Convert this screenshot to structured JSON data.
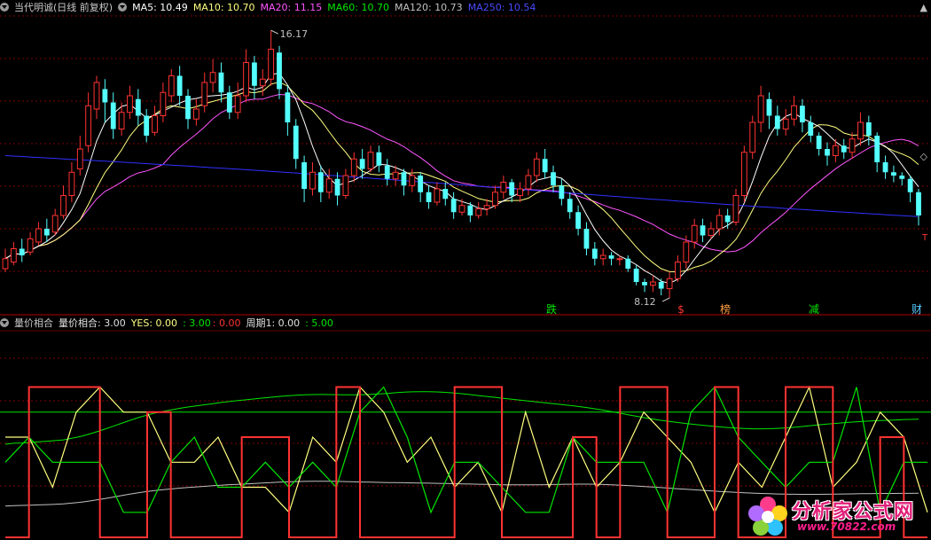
{
  "main_legend": {
    "title": "当代明诚(日线 前复权)",
    "ma5": "MA5: 10.49",
    "ma10": "MA10: 10.70",
    "ma20": "MA20: 11.15",
    "ma60": "MA60: 10.70",
    "ma120": "MA120: 10.73",
    "ma250": "MA250: 10.54"
  },
  "indicator_legend": {
    "name": "量价相合",
    "value": "量价相合: 3.00",
    "yes": "YES: 0.00",
    "green": ": 3.00",
    "red": ": 0.00",
    "period": "周期1: 0.00",
    "period_green": ": 5.00"
  },
  "annotations": {
    "high": "16.17",
    "low": "8.12",
    "markers": [
      "跌",
      "$",
      "榜",
      "减",
      "财"
    ],
    "marker_t": "T"
  },
  "watermark": {
    "title": "分析家公式网",
    "url": "www.70822.com"
  },
  "colors": {
    "up": "#ff3232",
    "down": "#54ffff",
    "ma5": "#ffffff",
    "ma10": "#ffff7f",
    "ma20": "#ff56ff",
    "ma60": "#00e600",
    "ma120": "#c0c0c0",
    "ma250": "#3030ff",
    "grid": "#800000"
  },
  "chart_data": [
    {
      "type": "candlestick",
      "series": [
        {
          "name": "MA5"
        },
        {
          "name": "MA10"
        },
        {
          "name": "MA20"
        },
        {
          "name": "MA60"
        },
        {
          "name": "MA120"
        },
        {
          "name": "MA250"
        }
      ],
      "ylim": [
        7.8,
        16.6
      ],
      "candles": [
        [
          9.0,
          9.3,
          9.6,
          8.9
        ],
        [
          9.2,
          9.6,
          9.8,
          9.1
        ],
        [
          9.6,
          9.4,
          9.9,
          9.2
        ],
        [
          9.5,
          9.9,
          10.1,
          9.4
        ],
        [
          9.8,
          10.2,
          10.4,
          9.7
        ],
        [
          10.2,
          10.0,
          10.5,
          9.8
        ],
        [
          10.1,
          10.6,
          10.8,
          10.0
        ],
        [
          10.6,
          11.2,
          11.5,
          10.5
        ],
        [
          11.2,
          11.9,
          12.2,
          11.0
        ],
        [
          12.0,
          12.6,
          13.0,
          11.8
        ],
        [
          12.7,
          13.9,
          14.3,
          12.5
        ],
        [
          13.8,
          14.6,
          14.8,
          13.5
        ],
        [
          14.4,
          14.0,
          14.7,
          13.4
        ],
        [
          14.0,
          13.2,
          14.3,
          12.9
        ],
        [
          13.2,
          13.7,
          14.0,
          13.0
        ],
        [
          13.7,
          14.2,
          14.5,
          13.5
        ],
        [
          14.1,
          13.6,
          14.4,
          13.3
        ],
        [
          13.6,
          13.0,
          13.8,
          12.8
        ],
        [
          13.1,
          13.6,
          13.9,
          13.0
        ],
        [
          13.6,
          14.3,
          14.6,
          13.4
        ],
        [
          14.2,
          14.8,
          15.0,
          14.0
        ],
        [
          14.8,
          14.2,
          15.1,
          13.9
        ],
        [
          14.2,
          13.5,
          14.4,
          13.2
        ],
        [
          13.5,
          13.8,
          14.1,
          13.3
        ],
        [
          13.9,
          14.6,
          14.9,
          13.7
        ],
        [
          14.6,
          14.9,
          15.3,
          14.3
        ],
        [
          14.9,
          14.3,
          15.2,
          14.0
        ],
        [
          14.3,
          13.7,
          14.5,
          13.5
        ],
        [
          13.7,
          14.2,
          14.6,
          13.5
        ],
        [
          14.2,
          15.2,
          15.6,
          14.0
        ],
        [
          15.2,
          14.5,
          15.4,
          14.1
        ],
        [
          14.5,
          14.7,
          15.0,
          14.2
        ],
        [
          14.7,
          15.6,
          16.17,
          14.5
        ],
        [
          15.5,
          14.4,
          15.7,
          14.1
        ],
        [
          14.3,
          13.4,
          14.5,
          13.0
        ],
        [
          13.3,
          12.3,
          13.5,
          12.0
        ],
        [
          12.2,
          11.4,
          12.4,
          11.0
        ],
        [
          11.4,
          11.9,
          12.2,
          11.2
        ],
        [
          11.9,
          11.3,
          12.1,
          11.0
        ],
        [
          11.3,
          11.7,
          12.0,
          11.1
        ],
        [
          11.7,
          11.2,
          11.9,
          10.9
        ],
        [
          11.2,
          11.8,
          12.0,
          11.1
        ],
        [
          11.8,
          12.3,
          12.5,
          11.6
        ],
        [
          12.3,
          12.0,
          12.6,
          11.7
        ],
        [
          12.0,
          12.5,
          12.7,
          11.9
        ],
        [
          12.5,
          12.1,
          12.7,
          11.9
        ],
        [
          12.1,
          11.7,
          12.3,
          11.5
        ],
        [
          11.7,
          11.9,
          12.1,
          11.5
        ],
        [
          11.9,
          11.5,
          12.0,
          11.2
        ],
        [
          11.5,
          11.8,
          12.0,
          11.3
        ],
        [
          11.8,
          11.3,
          11.9,
          11.0
        ],
        [
          11.3,
          11.0,
          11.5,
          10.8
        ],
        [
          11.0,
          11.4,
          11.6,
          10.9
        ],
        [
          11.4,
          11.1,
          11.6,
          10.9
        ],
        [
          11.1,
          10.7,
          11.3,
          10.5
        ],
        [
          10.7,
          10.9,
          11.1,
          10.6
        ],
        [
          10.9,
          10.6,
          11.0,
          10.4
        ],
        [
          10.6,
          10.8,
          11.0,
          10.5
        ],
        [
          10.8,
          10.9,
          11.1,
          10.6
        ],
        [
          10.9,
          11.3,
          11.5,
          10.8
        ],
        [
          11.3,
          11.6,
          11.8,
          11.1
        ],
        [
          11.6,
          11.2,
          11.7,
          11.0
        ],
        [
          11.2,
          11.4,
          11.6,
          11.0
        ],
        [
          11.4,
          11.8,
          12.0,
          11.2
        ],
        [
          11.8,
          12.3,
          12.5,
          11.6
        ],
        [
          12.3,
          11.9,
          12.6,
          11.7
        ],
        [
          11.9,
          11.5,
          12.1,
          11.3
        ],
        [
          11.5,
          11.1,
          11.7,
          10.9
        ],
        [
          11.1,
          10.7,
          11.3,
          10.5
        ],
        [
          10.7,
          10.2,
          10.9,
          10.0
        ],
        [
          10.2,
          9.6,
          10.4,
          9.4
        ],
        [
          9.6,
          9.3,
          9.8,
          9.1
        ],
        [
          9.3,
          9.4,
          9.6,
          9.1
        ],
        [
          9.4,
          9.3,
          9.5,
          9.1
        ],
        [
          9.3,
          9.3,
          9.4,
          9.1
        ],
        [
          9.3,
          9.0,
          9.4,
          8.9
        ],
        [
          9.0,
          8.6,
          9.1,
          8.5
        ],
        [
          8.6,
          8.5,
          8.7,
          8.3
        ],
        [
          8.5,
          8.6,
          8.8,
          8.3
        ],
        [
          8.6,
          8.4,
          8.7,
          8.2
        ],
        [
          8.4,
          8.7,
          8.9,
          8.12
        ],
        [
          8.7,
          9.2,
          9.4,
          8.6
        ],
        [
          9.2,
          9.8,
          10.0,
          9.0
        ],
        [
          9.8,
          10.3,
          10.5,
          9.6
        ],
        [
          10.3,
          10.0,
          10.5,
          9.8
        ],
        [
          10.0,
          10.2,
          10.4,
          9.9
        ],
        [
          10.2,
          10.6,
          10.8,
          10.0
        ],
        [
          10.6,
          10.4,
          10.8,
          10.2
        ],
        [
          10.4,
          11.2,
          11.4,
          10.3
        ],
        [
          11.2,
          12.5,
          12.7,
          11.0
        ],
        [
          12.5,
          13.4,
          13.6,
          12.3
        ],
        [
          13.4,
          14.2,
          14.5,
          13.1
        ],
        [
          14.1,
          13.6,
          14.3,
          13.2
        ],
        [
          13.6,
          13.2,
          13.9,
          13.0
        ],
        [
          13.2,
          13.5,
          13.8,
          13.0
        ],
        [
          13.5,
          13.9,
          14.2,
          13.3
        ],
        [
          13.9,
          13.4,
          14.1,
          13.1
        ],
        [
          13.4,
          13.0,
          13.6,
          12.8
        ],
        [
          13.0,
          12.6,
          13.1,
          12.4
        ],
        [
          12.6,
          12.4,
          12.8,
          12.1
        ],
        [
          12.4,
          12.7,
          12.9,
          12.2
        ],
        [
          12.7,
          12.5,
          12.9,
          12.3
        ],
        [
          12.5,
          12.9,
          13.1,
          12.3
        ],
        [
          12.9,
          13.4,
          13.7,
          12.7
        ],
        [
          13.4,
          13.0,
          13.6,
          12.7
        ],
        [
          13.0,
          12.2,
          13.1,
          11.9
        ],
        [
          12.2,
          11.9,
          12.4,
          11.7
        ],
        [
          11.9,
          11.8,
          12.1,
          11.6
        ],
        [
          11.8,
          11.7,
          11.9,
          11.5
        ],
        [
          11.7,
          11.3,
          11.8,
          11.0
        ],
        [
          11.3,
          10.6,
          11.4,
          10.3
        ]
      ]
    },
    {
      "type": "line",
      "title": "量价相合",
      "ylim": [
        0,
        8
      ],
      "reference_line": 5.0,
      "series": [
        {
          "name": "YES",
          "values": [
            4,
            4,
            2,
            5,
            6,
            5,
            5,
            3,
            3,
            4,
            2,
            2,
            1,
            4,
            3,
            6,
            5,
            3,
            4,
            2,
            3,
            1,
            5,
            2,
            4,
            2,
            3,
            5,
            4,
            3,
            1,
            3,
            2,
            4,
            6,
            2,
            3,
            5,
            4,
            1
          ]
        },
        {
          "name": "量价相合",
          "values": [
            3,
            4,
            3,
            3,
            3,
            1,
            1,
            3,
            4,
            2,
            2,
            3,
            2,
            3,
            2,
            5,
            6,
            4,
            1,
            3,
            3,
            2,
            1,
            1,
            4,
            3,
            3,
            3,
            1,
            5,
            6,
            4,
            3,
            2,
            3,
            3,
            6,
            1,
            3,
            3
          ]
        },
        {
          "name": "周期1",
          "values": [
            0,
            6,
            6,
            6,
            0,
            0,
            5,
            0,
            0,
            0,
            4,
            4,
            0,
            0,
            6,
            0,
            0,
            0,
            0,
            6,
            6,
            0,
            0,
            0,
            4,
            0,
            6,
            6,
            0,
            0,
            6,
            0,
            0,
            6,
            6,
            0,
            0,
            4,
            0,
            0
          ]
        }
      ]
    }
  ]
}
